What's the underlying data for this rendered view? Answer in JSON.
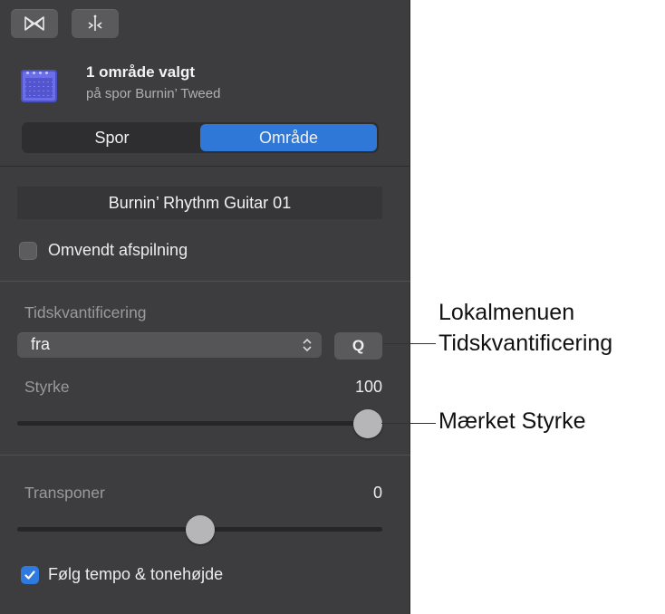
{
  "toolbar": {
    "loop_icon": "loop-icon",
    "tuning_icon": "tuning-fork-icon"
  },
  "region": {
    "icon": "amp-icon",
    "title": "1 område valgt",
    "subtitle": "på spor Burnin’ Tweed"
  },
  "tabs": [
    {
      "label": "Spor",
      "active": false
    },
    {
      "label": "Område",
      "active": true
    }
  ],
  "region_name": "Burnin’ Rhythm Guitar 01",
  "reverse": {
    "label": "Omvendt afspilning",
    "checked": false
  },
  "quantize": {
    "label": "Tidskvantificering",
    "value": "fra",
    "q_button": "Q"
  },
  "strength": {
    "label": "Styrke",
    "value": "100",
    "level": 1.0
  },
  "transpose": {
    "label": "Transponer",
    "value": "0",
    "level": 0.5
  },
  "follow": {
    "label": "Følg tempo & tonehøjde",
    "checked": true
  },
  "callouts": {
    "quantize_line1": "Lokalmenuen",
    "quantize_line2": "Tidskvantificering",
    "strength": "Mærket Styrke"
  },
  "colors": {
    "panel": "#3d3d3f",
    "accent": "#2f78d7",
    "region_icon": "#6a6ee8"
  }
}
